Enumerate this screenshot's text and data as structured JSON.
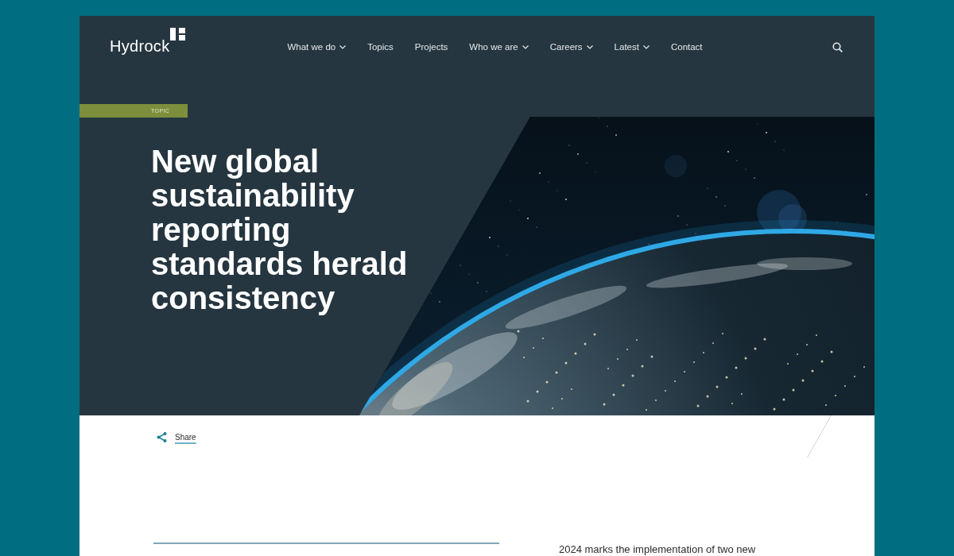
{
  "header": {
    "logo": "Hydrock",
    "nav": [
      {
        "label": "What we do",
        "dropdown": true
      },
      {
        "label": "Topics",
        "dropdown": false
      },
      {
        "label": "Projects",
        "dropdown": false
      },
      {
        "label": "Who we are",
        "dropdown": true
      },
      {
        "label": "Careers",
        "dropdown": true
      },
      {
        "label": "Latest",
        "dropdown": true
      },
      {
        "label": "Contact",
        "dropdown": false
      }
    ]
  },
  "hero": {
    "tag": "TOPIC",
    "title": "New global sustainability reporting standards herald consistency"
  },
  "share": {
    "label": "Share"
  },
  "article": {
    "intro": "2024 marks the implementation of two new"
  }
}
